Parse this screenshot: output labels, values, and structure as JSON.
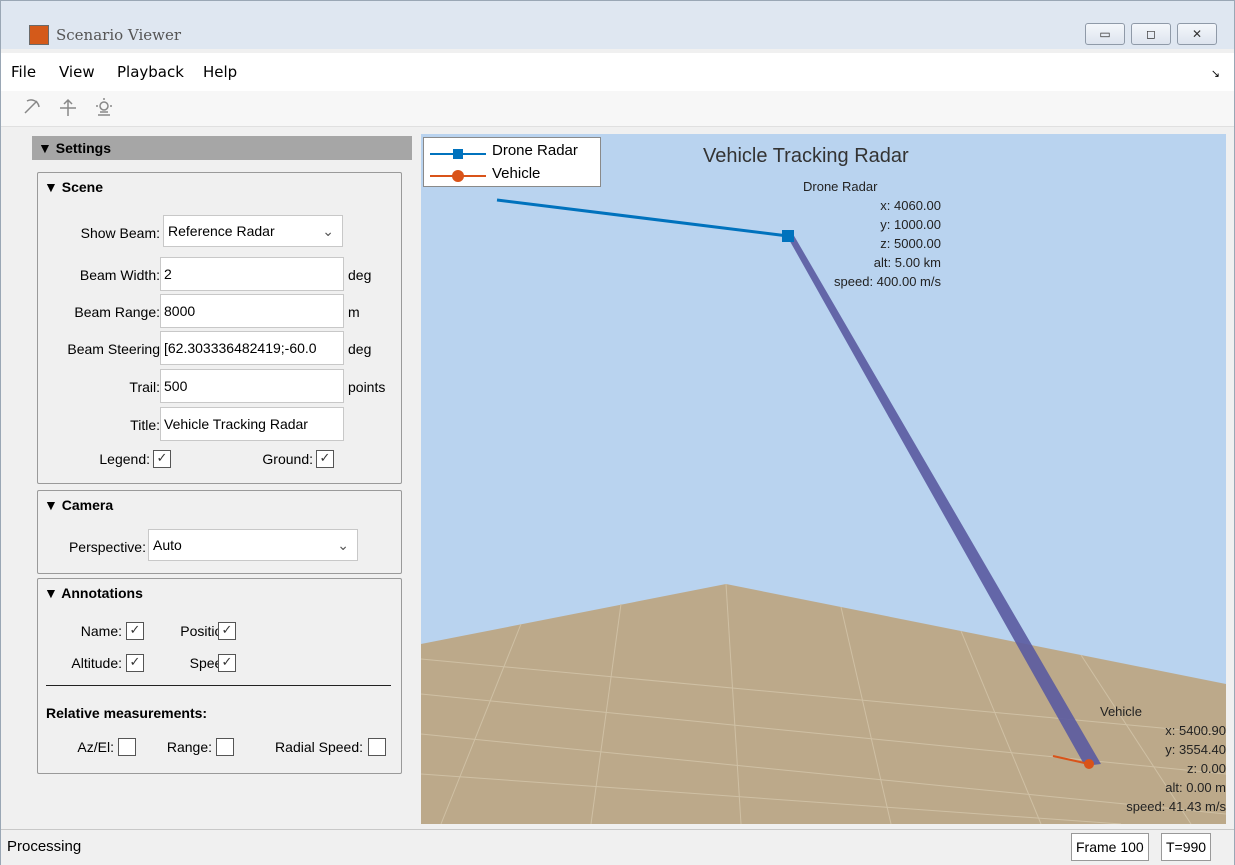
{
  "window": {
    "title": "Scenario Viewer",
    "btn_minimize": "▭",
    "btn_maximize": "◻",
    "btn_close": "✕"
  },
  "menu": {
    "items": [
      "File",
      "View",
      "Playback",
      "Help"
    ],
    "corner": "↘"
  },
  "toolbar": {
    "icons": [
      "rotate-icon",
      "pan-icon",
      "light-icon"
    ]
  },
  "settings": {
    "header": "▼ Settings",
    "scene": {
      "title": "▼ Scene",
      "show_beam_label": "Show Beam:",
      "show_beam_value": "Reference Radar",
      "beam_width_label": "Beam Width:",
      "beam_width_value": "2",
      "beam_width_unit": "deg",
      "beam_range_label": "Beam Range:",
      "beam_range_value": "8000",
      "beam_range_unit": "m",
      "beam_steering_label": "Beam Steering",
      "beam_steering_value": "[62.303336482419;-60.0",
      "beam_steering_unit": "deg",
      "trail_label": "Trail:",
      "trail_value": "500",
      "trail_unit": "points",
      "title_label": "Title:",
      "title_value": "Vehicle Tracking Radar",
      "legend_label": "Legend:",
      "legend_checked": true,
      "ground_label": "Ground:",
      "ground_checked": true
    },
    "camera": {
      "title": "▼ Camera",
      "perspective_label": "Perspective:",
      "perspective_value": "Auto"
    },
    "annotations": {
      "title": "▼ Annotations",
      "name_label": "Name:",
      "name_checked": true,
      "position_label": "Position:",
      "position_checked": true,
      "altitude_label": "Altitude:",
      "altitude_checked": true,
      "speed_label": "Speed:",
      "speed_checked": true,
      "relative_title": "Relative measurements:",
      "azel_label": "Az/El:",
      "azel_checked": false,
      "range_label": "Range:",
      "range_checked": false,
      "radial_speed_label": "Radial Speed:",
      "radial_speed_checked": false
    }
  },
  "plot": {
    "title": "Vehicle Tracking Radar",
    "legend": [
      {
        "name": "Drone Radar",
        "color": "#0072bd"
      },
      {
        "name": "Vehicle",
        "color": "#d95319"
      }
    ],
    "radar_annotation": [
      "Drone Radar",
      "x: 4060.00",
      "y: 1000.00",
      "z: 5000.00",
      "alt: 5.00 km",
      "speed: 400.00 m/s"
    ],
    "vehicle_annotation": [
      "Vehicle",
      "x: 5400.90",
      "y: 3554.40",
      "z: 0.00",
      "alt: 0.00 m",
      "speed: 41.43 m/s"
    ],
    "colors": {
      "sky": "#b9d3ef",
      "ground": "#bca98a",
      "beam": "#5a5aa0"
    }
  },
  "status": {
    "text": "Processing",
    "frame": "Frame 100",
    "time": "T=990"
  }
}
